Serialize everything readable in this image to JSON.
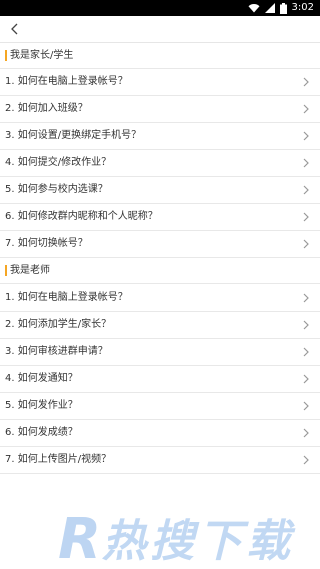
{
  "status_bar": {
    "time": "3:02"
  },
  "sections": [
    {
      "title": "我是家长/学生",
      "items": [
        "1. 如何在电脑上登录帐号？",
        "2. 如何加入班级？",
        "3. 如何设置/更换绑定手机号？",
        "4. 如何提交/修改作业？",
        "5. 如何参与校内选课？",
        "6. 如何修改群内昵称和个人昵称？",
        "7. 如何切换帐号？"
      ]
    },
    {
      "title": "我是老师",
      "items": [
        "1. 如何在电脑上登录帐号？",
        "2. 如何添加学生/家长？",
        "3. 如何审核进群申请？",
        "4. 如何发通知？",
        "5. 如何发作业？",
        "6. 如何发成绩？",
        "7. 如何上传图片/视频？"
      ]
    }
  ],
  "watermark": {
    "text": "热搜下载",
    "brand_letter": "R",
    "color": "#a8c8ee"
  },
  "colors": {
    "accent": "#f5a623",
    "divider": "#e8e8e8",
    "chevron": "#999999"
  }
}
